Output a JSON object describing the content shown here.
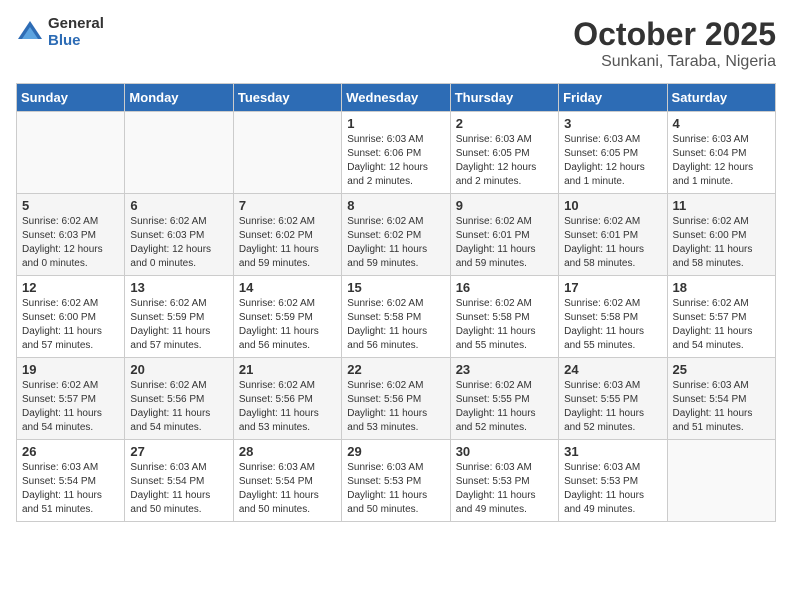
{
  "header": {
    "logo": {
      "line1": "General",
      "line2": "Blue"
    },
    "title": "October 2025",
    "subtitle": "Sunkani, Taraba, Nigeria"
  },
  "days_of_week": [
    "Sunday",
    "Monday",
    "Tuesday",
    "Wednesday",
    "Thursday",
    "Friday",
    "Saturday"
  ],
  "weeks": [
    [
      {
        "day": "",
        "info": ""
      },
      {
        "day": "",
        "info": ""
      },
      {
        "day": "",
        "info": ""
      },
      {
        "day": "1",
        "info": "Sunrise: 6:03 AM\nSunset: 6:06 PM\nDaylight: 12 hours\nand 2 minutes."
      },
      {
        "day": "2",
        "info": "Sunrise: 6:03 AM\nSunset: 6:05 PM\nDaylight: 12 hours\nand 2 minutes."
      },
      {
        "day": "3",
        "info": "Sunrise: 6:03 AM\nSunset: 6:05 PM\nDaylight: 12 hours\nand 1 minute."
      },
      {
        "day": "4",
        "info": "Sunrise: 6:03 AM\nSunset: 6:04 PM\nDaylight: 12 hours\nand 1 minute."
      }
    ],
    [
      {
        "day": "5",
        "info": "Sunrise: 6:02 AM\nSunset: 6:03 PM\nDaylight: 12 hours\nand 0 minutes."
      },
      {
        "day": "6",
        "info": "Sunrise: 6:02 AM\nSunset: 6:03 PM\nDaylight: 12 hours\nand 0 minutes."
      },
      {
        "day": "7",
        "info": "Sunrise: 6:02 AM\nSunset: 6:02 PM\nDaylight: 11 hours\nand 59 minutes."
      },
      {
        "day": "8",
        "info": "Sunrise: 6:02 AM\nSunset: 6:02 PM\nDaylight: 11 hours\nand 59 minutes."
      },
      {
        "day": "9",
        "info": "Sunrise: 6:02 AM\nSunset: 6:01 PM\nDaylight: 11 hours\nand 59 minutes."
      },
      {
        "day": "10",
        "info": "Sunrise: 6:02 AM\nSunset: 6:01 PM\nDaylight: 11 hours\nand 58 minutes."
      },
      {
        "day": "11",
        "info": "Sunrise: 6:02 AM\nSunset: 6:00 PM\nDaylight: 11 hours\nand 58 minutes."
      }
    ],
    [
      {
        "day": "12",
        "info": "Sunrise: 6:02 AM\nSunset: 6:00 PM\nDaylight: 11 hours\nand 57 minutes."
      },
      {
        "day": "13",
        "info": "Sunrise: 6:02 AM\nSunset: 5:59 PM\nDaylight: 11 hours\nand 57 minutes."
      },
      {
        "day": "14",
        "info": "Sunrise: 6:02 AM\nSunset: 5:59 PM\nDaylight: 11 hours\nand 56 minutes."
      },
      {
        "day": "15",
        "info": "Sunrise: 6:02 AM\nSunset: 5:58 PM\nDaylight: 11 hours\nand 56 minutes."
      },
      {
        "day": "16",
        "info": "Sunrise: 6:02 AM\nSunset: 5:58 PM\nDaylight: 11 hours\nand 55 minutes."
      },
      {
        "day": "17",
        "info": "Sunrise: 6:02 AM\nSunset: 5:58 PM\nDaylight: 11 hours\nand 55 minutes."
      },
      {
        "day": "18",
        "info": "Sunrise: 6:02 AM\nSunset: 5:57 PM\nDaylight: 11 hours\nand 54 minutes."
      }
    ],
    [
      {
        "day": "19",
        "info": "Sunrise: 6:02 AM\nSunset: 5:57 PM\nDaylight: 11 hours\nand 54 minutes."
      },
      {
        "day": "20",
        "info": "Sunrise: 6:02 AM\nSunset: 5:56 PM\nDaylight: 11 hours\nand 54 minutes."
      },
      {
        "day": "21",
        "info": "Sunrise: 6:02 AM\nSunset: 5:56 PM\nDaylight: 11 hours\nand 53 minutes."
      },
      {
        "day": "22",
        "info": "Sunrise: 6:02 AM\nSunset: 5:56 PM\nDaylight: 11 hours\nand 53 minutes."
      },
      {
        "day": "23",
        "info": "Sunrise: 6:02 AM\nSunset: 5:55 PM\nDaylight: 11 hours\nand 52 minutes."
      },
      {
        "day": "24",
        "info": "Sunrise: 6:03 AM\nSunset: 5:55 PM\nDaylight: 11 hours\nand 52 minutes."
      },
      {
        "day": "25",
        "info": "Sunrise: 6:03 AM\nSunset: 5:54 PM\nDaylight: 11 hours\nand 51 minutes."
      }
    ],
    [
      {
        "day": "26",
        "info": "Sunrise: 6:03 AM\nSunset: 5:54 PM\nDaylight: 11 hours\nand 51 minutes."
      },
      {
        "day": "27",
        "info": "Sunrise: 6:03 AM\nSunset: 5:54 PM\nDaylight: 11 hours\nand 50 minutes."
      },
      {
        "day": "28",
        "info": "Sunrise: 6:03 AM\nSunset: 5:54 PM\nDaylight: 11 hours\nand 50 minutes."
      },
      {
        "day": "29",
        "info": "Sunrise: 6:03 AM\nSunset: 5:53 PM\nDaylight: 11 hours\nand 50 minutes."
      },
      {
        "day": "30",
        "info": "Sunrise: 6:03 AM\nSunset: 5:53 PM\nDaylight: 11 hours\nand 49 minutes."
      },
      {
        "day": "31",
        "info": "Sunrise: 6:03 AM\nSunset: 5:53 PM\nDaylight: 11 hours\nand 49 minutes."
      },
      {
        "day": "",
        "info": ""
      }
    ]
  ]
}
